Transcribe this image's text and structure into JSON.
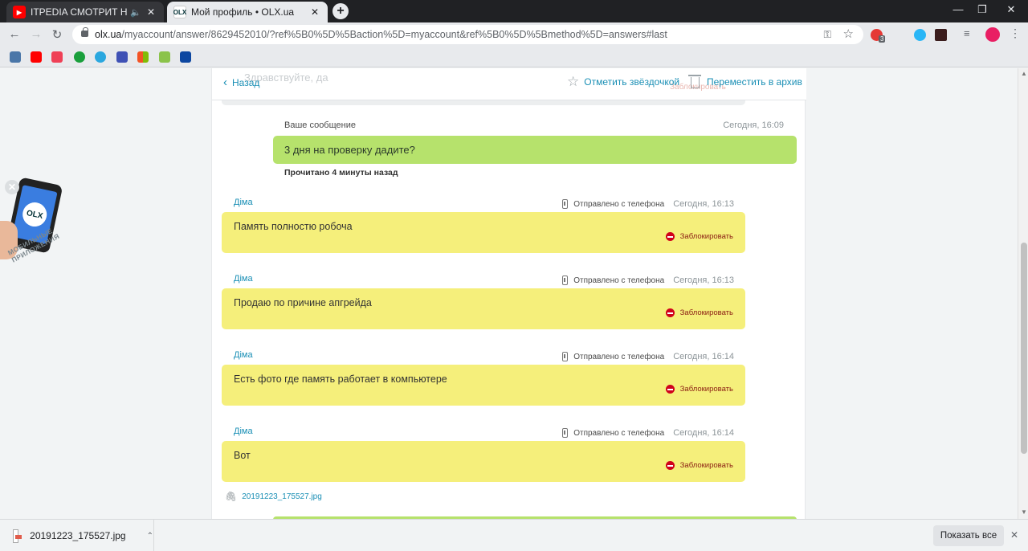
{
  "browser": {
    "tabs": [
      {
        "title": "ITPEDIA СМОТРИТ НОВОГО",
        "favicon": "youtube-icon",
        "audio": true
      },
      {
        "title": "Мой профиль • OLX.ua",
        "favicon": "olx-icon",
        "active": true
      }
    ],
    "new_tab": "+",
    "url_host": "olx.ua",
    "url_path": "/myaccount/answer/8629452010/?ref%5B0%5D%5Baction%5D=myaccount&ref%5B0%5D%5Bmethod%5D=answers#last",
    "extension_badge": "3"
  },
  "bookmarks": [
    {
      "icon": "vk-icon",
      "color": "#4a76a8"
    },
    {
      "icon": "youtube-icon",
      "color": "#ff0000"
    },
    {
      "icon": "pocket-icon",
      "color": "#ef4056"
    },
    {
      "icon": "green-ball-icon",
      "color": "#1a9f3c"
    },
    {
      "icon": "snowflake-icon",
      "color": "#2aa7df"
    },
    {
      "icon": "sigma-icon",
      "color": "#3f51b5"
    },
    {
      "icon": "windows-icon",
      "color": "#f35325"
    },
    {
      "icon": "a-icon",
      "color": "#8bc34a"
    },
    {
      "icon": "stripe-icon",
      "color": "#0d47a1"
    }
  ],
  "header": {
    "back_label": "Назад",
    "star_label": "Отметить звёздочкой",
    "archive_label": "Переместить в архив",
    "ghost_text": "Здравствуйте, да",
    "ghost_block": "Заблокировать"
  },
  "own_message": {
    "header": "Ваше сообщение",
    "time": "Сегодня, 16:09",
    "text": "3 дня на проверку дадите?",
    "read_status": "Прочитано 4 минуты назад"
  },
  "messages": [
    {
      "author": "Діма",
      "sent_via": "Отправлено с телефона",
      "time": "Сегодня, 16:13",
      "text": "Память полностю робоча",
      "block": "Заблокировать"
    },
    {
      "author": "Діма",
      "sent_via": "Отправлено с телефона",
      "time": "Сегодня, 16:13",
      "text": "Продаю по причине апгрейда",
      "block": "Заблокировать"
    },
    {
      "author": "Діма",
      "sent_via": "Отправлено с телефона",
      "time": "Сегодня, 16:14",
      "text": "Есть фото где память работает в компьютере",
      "block": "Заблокировать"
    },
    {
      "author": "Діма",
      "sent_via": "Отправлено с телефона",
      "time": "Сегодня, 16:14",
      "text": "Вот",
      "block": "Заблокировать"
    }
  ],
  "attachment": "20191223_175527.jpg",
  "promo": {
    "logo": "OLX",
    "caption": "МОБИЛЬНЫЕ ПРИЛОЖЕНИЯ"
  },
  "downloads": {
    "file": "20191223_175527.jpg",
    "show_all": "Показать все"
  },
  "colors": {
    "accent": "#1a8fb5",
    "own_bubble": "#b6e26c",
    "their_bubble": "#f5ef7b",
    "block": "#d0021b"
  }
}
